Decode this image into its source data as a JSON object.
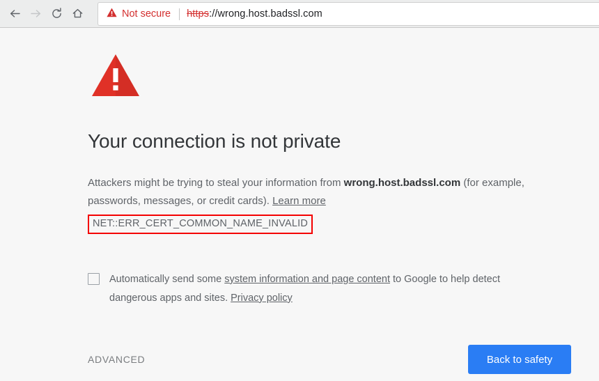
{
  "browser": {
    "nav": {
      "back_label": "Back",
      "forward_label": "Forward",
      "reload_label": "Reload",
      "home_label": "Home"
    },
    "omnibox": {
      "security_label": "Not secure",
      "url_scheme": "https",
      "url_rest": "://wrong.host.badssl.com",
      "full_url": "https://wrong.host.badssl.com"
    }
  },
  "interstitial": {
    "icon": "warning-triangle-icon",
    "heading": "Your connection is not private",
    "body_part1": "Attackers might be trying to steal your information from ",
    "body_host": "wrong.host.badssl.com",
    "body_part2": " (for example, passwords, messages, or credit cards). ",
    "learn_more": "Learn more",
    "error_code": "NET::ERR_CERT_COMMON_NAME_INVALID",
    "optin": {
      "text_part1": "Automatically send some ",
      "link1": "system information and page content",
      "text_part2": " to Google to help detect dangerous apps and sites. ",
      "link2": "Privacy policy",
      "checked": false
    },
    "advanced_label": "ADVANCED",
    "back_to_safety_label": "Back to safety"
  },
  "colors": {
    "warning_red": "#e03127",
    "not_secure_red": "#d32f2f",
    "annotation_red": "#f40000",
    "primary_blue": "#2a7df4",
    "page_bg": "#f7f7f7",
    "toolbar_bg": "#eceded"
  }
}
